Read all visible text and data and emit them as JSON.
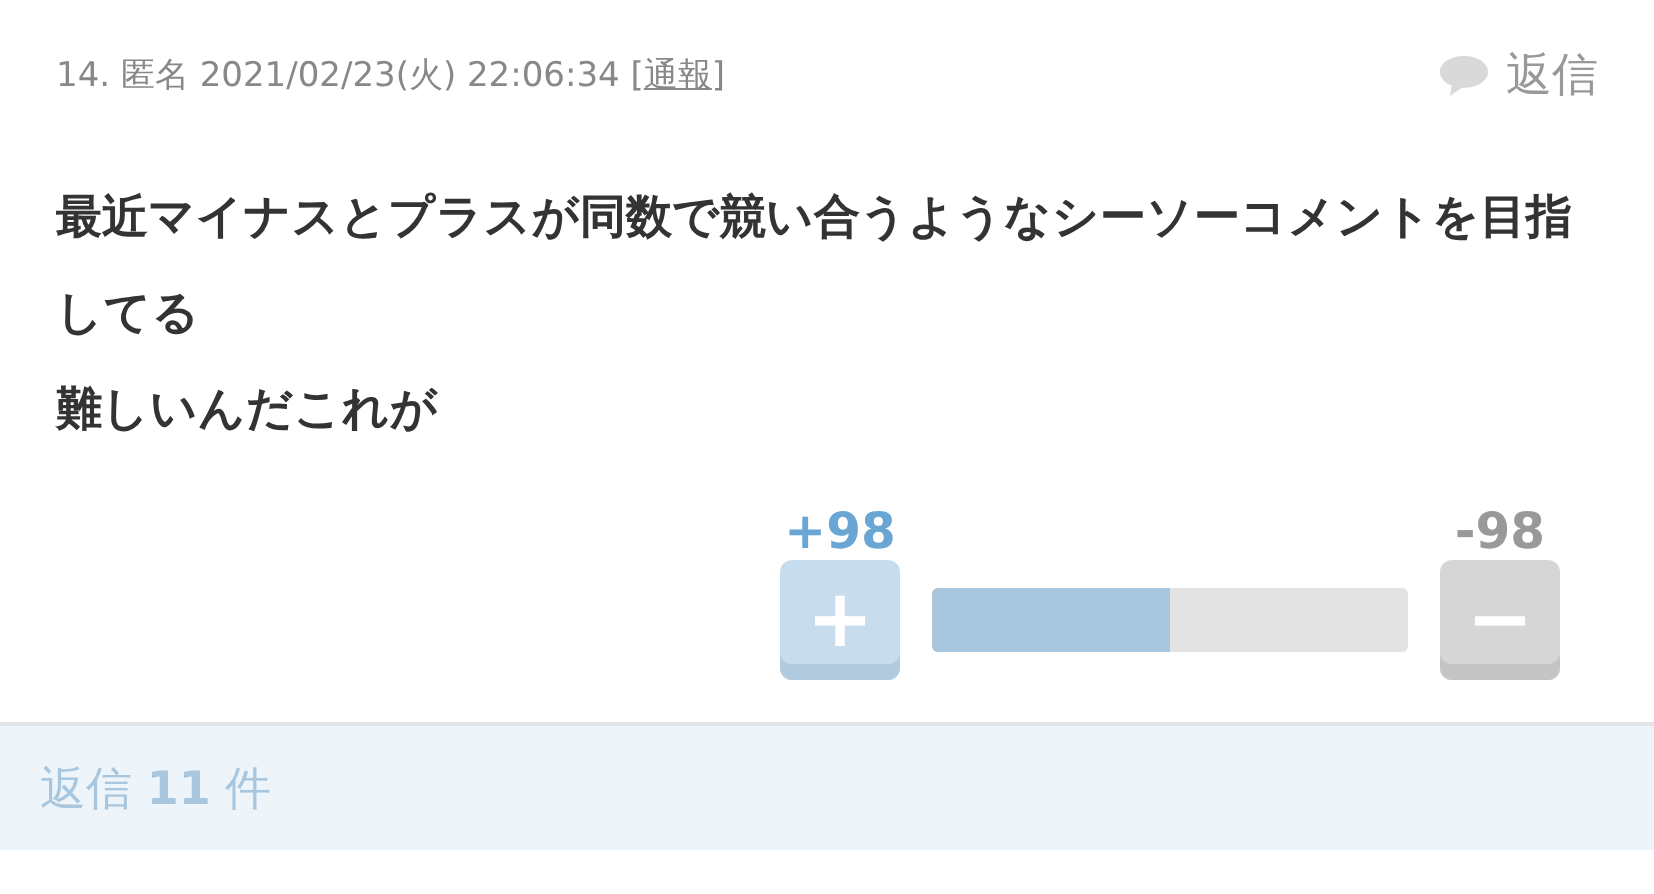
{
  "comment": {
    "meta": "14. 匿名 2021/02/23(火) 22:06:34",
    "report_open": "[",
    "report": "通報",
    "report_close": "]",
    "reply": "返信",
    "body": [
      "最近マイナスとプラスが同数で競い合うようなシーソーコメントを目指してる",
      "難しいんだこれが"
    ],
    "vote": {
      "plus_count": "+98",
      "minus_count": "-98",
      "plus_symbol": "+",
      "minus_symbol": "−",
      "level": 0.5
    }
  },
  "replies": {
    "label": "返信 **11** 件"
  }
}
